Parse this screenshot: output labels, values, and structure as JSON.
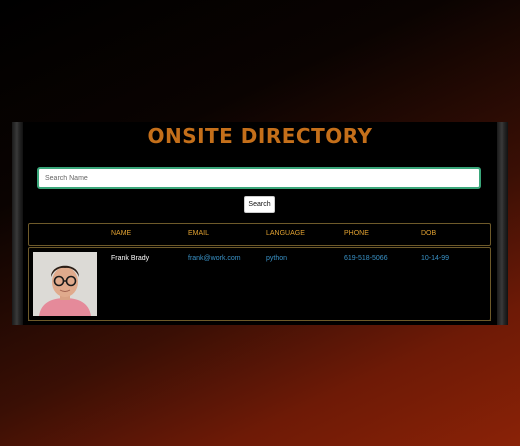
{
  "page": {
    "title": "ONSITE DIRECTORY"
  },
  "search": {
    "placeholder": "Search Name",
    "value": "",
    "button_label": "Search"
  },
  "table": {
    "columns": [
      "NAME",
      "EMAIL",
      "LANGUAGE",
      "PHONE",
      "DOB"
    ],
    "rows": [
      {
        "name": "Frank Brady",
        "email": "frank@work.com",
        "language": "python",
        "phone": "619-518-5066",
        "dob": "10-14-99"
      }
    ]
  },
  "colors": {
    "title": "#c46f1a",
    "header_text": "#e0a030",
    "link_text": "#3a93c8",
    "border": "#6e5a2a",
    "search_border": "#3aa67a"
  }
}
